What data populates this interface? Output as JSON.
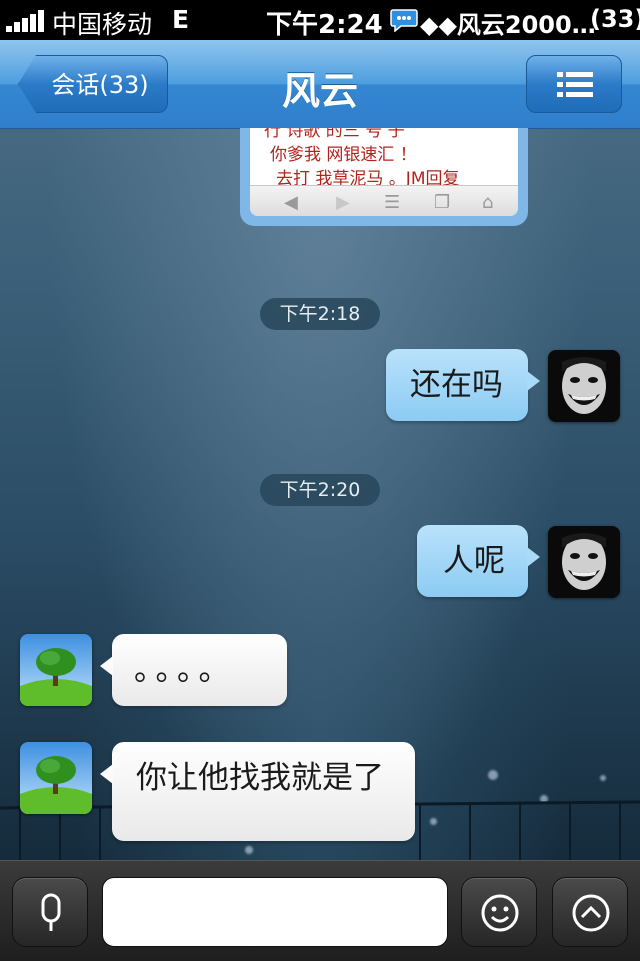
{
  "status_bar": {
    "carrier": "中国移动",
    "network": "E",
    "time": "下午2:24",
    "notification": "◆◆风云2000…",
    "notification_count": "(33)"
  },
  "nav": {
    "back_label": "会话(33)",
    "title": "风云"
  },
  "card": {
    "lines": [
      "你爹我 网银速汇 ！",
      "去打   我草泥马    。JM回复"
    ]
  },
  "messages": [
    {
      "type": "timestamp",
      "text": "下午2:18"
    },
    {
      "type": "outgoing",
      "text": "还在吗"
    },
    {
      "type": "timestamp",
      "text": "下午2:20"
    },
    {
      "type": "outgoing",
      "text": "人呢"
    },
    {
      "type": "incoming",
      "text": "。。。。"
    },
    {
      "type": "incoming",
      "text": "你让他找我就是了"
    }
  ],
  "input": {
    "value": "",
    "placeholder": ""
  },
  "colors": {
    "nav_blue": "#3587d2",
    "outgoing_bubble": "#8ccbf3",
    "incoming_bubble": "#ffffff"
  }
}
